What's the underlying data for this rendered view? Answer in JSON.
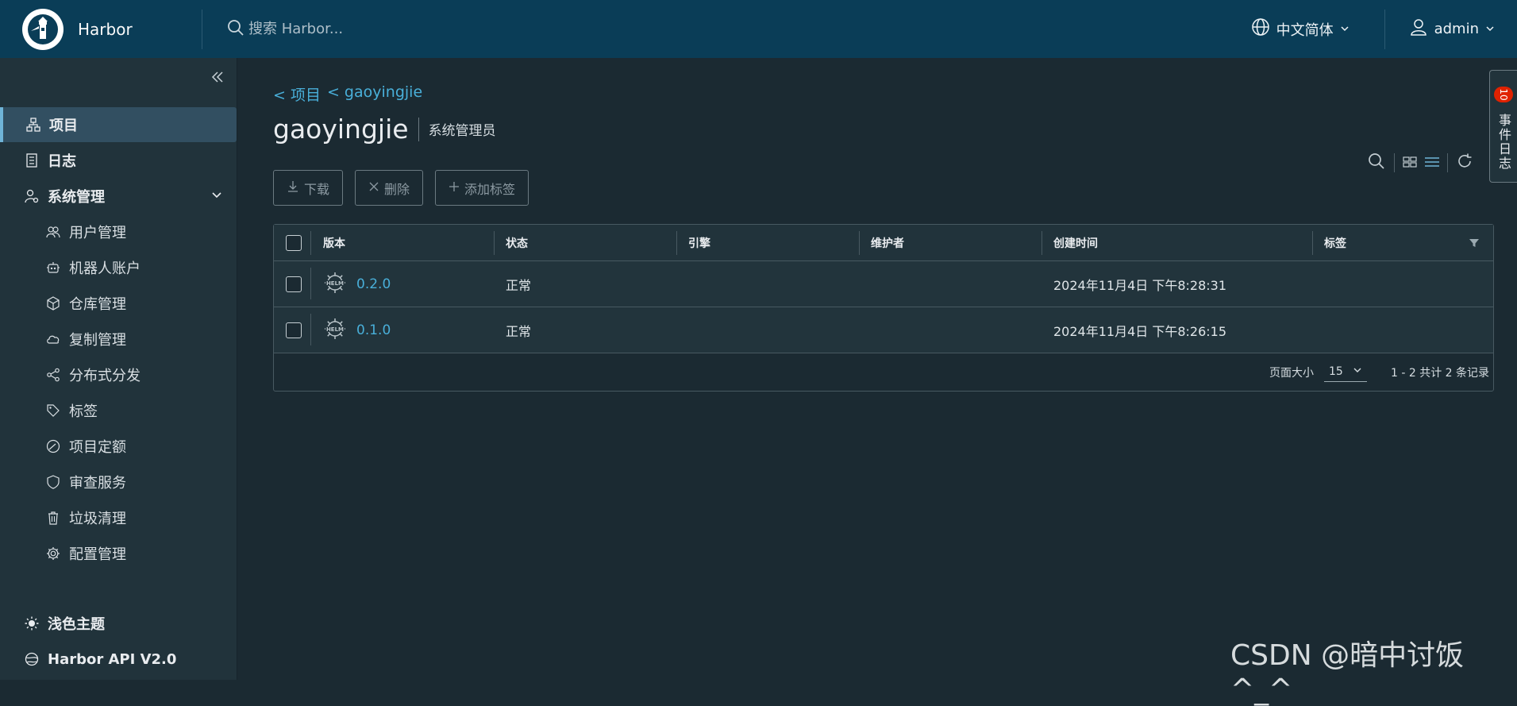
{
  "header": {
    "brand": "Harbor",
    "search_placeholder": "搜索 Harbor...",
    "language": "中文简体",
    "user": "admin"
  },
  "sidebar": {
    "items": [
      {
        "label": "项目",
        "icon": "project-icon",
        "active": true
      },
      {
        "label": "日志",
        "icon": "log-icon"
      },
      {
        "label": "系统管理",
        "icon": "admin-icon"
      },
      {
        "label": "用户管理",
        "icon": "users-icon"
      },
      {
        "label": "机器人账户",
        "icon": "robot-icon"
      },
      {
        "label": "仓库管理",
        "icon": "registry-icon"
      },
      {
        "label": "复制管理",
        "icon": "cloud-icon"
      },
      {
        "label": "分布式分发",
        "icon": "share-icon"
      },
      {
        "label": "标签",
        "icon": "tag-icon"
      },
      {
        "label": "项目定额",
        "icon": "quota-icon"
      },
      {
        "label": "审查服务",
        "icon": "shield-icon"
      },
      {
        "label": "垃圾清理",
        "icon": "trash-icon"
      },
      {
        "label": "配置管理",
        "icon": "gear-icon"
      }
    ],
    "theme": "浅色主题",
    "api": "Harbor API V2.0"
  },
  "breadcrumb": {
    "project": "< 项目",
    "repo": "< gaoyingjie"
  },
  "page": {
    "title": "gaoyingjie",
    "role": "系统管理员"
  },
  "toolbar": {
    "download": "下载",
    "delete": "删除",
    "add_label": "添加标签"
  },
  "table": {
    "columns": [
      "版本",
      "状态",
      "引擎",
      "维护者",
      "创建时间",
      "标签"
    ],
    "rows": [
      {
        "version": "0.2.0",
        "status": "正常",
        "engine": "",
        "maintainer": "",
        "created": "2024年11月4日 下午8:28:31",
        "labels": ""
      },
      {
        "version": "0.1.0",
        "status": "正常",
        "engine": "",
        "maintainer": "",
        "created": "2024年11月4日 下午8:26:15",
        "labels": ""
      }
    ],
    "footer": {
      "page_size_label": "页面大小",
      "page_size": "15",
      "summary": "1 - 2 共计 2 条记录"
    }
  },
  "event_panel": {
    "label": "事件日志",
    "count": "10"
  },
  "watermark": "CSDN @暗中讨饭^_^",
  "colors": {
    "header_bg": "#0a3d57",
    "sidebar_bg": "#21333b",
    "main_bg": "#1b2a32",
    "link": "#49afd9",
    "badge": "#e02200"
  }
}
